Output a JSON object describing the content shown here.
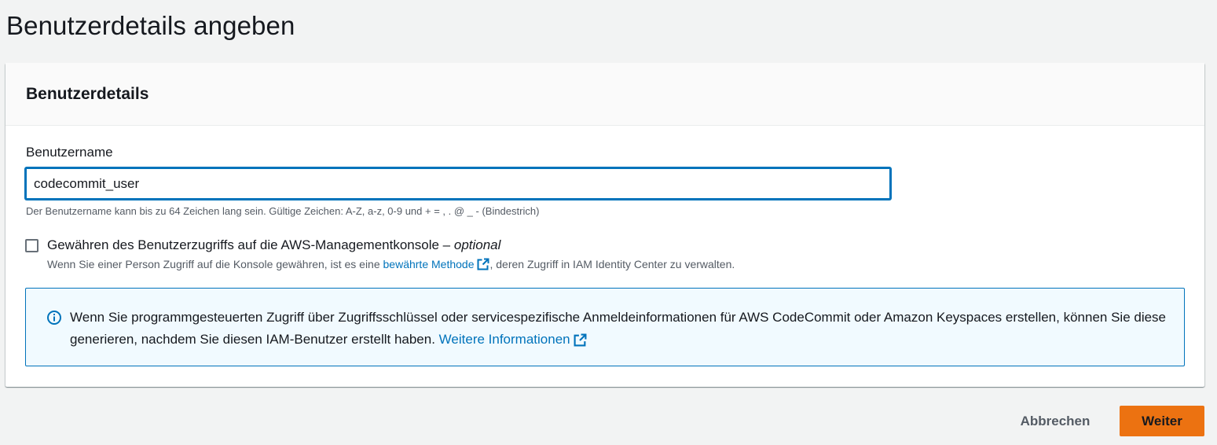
{
  "page": {
    "title": "Benutzerdetails angeben"
  },
  "user_details": {
    "heading": "Benutzerdetails",
    "username": {
      "label": "Benutzername",
      "value": "codecommit_user",
      "constraint": "Der Benutzername kann bis zu 64 Zeichen lang sein. Gültige Zeichen: A-Z, a-z, 0-9 und + = , . @ _ - (Bindestrich)"
    },
    "console_access": {
      "label": "Gewähren des Benutzerzugriffs auf die AWS-Managementkonsole – ",
      "optional": "optional",
      "checked": false,
      "desc_prefix": "Wenn Sie einer Person Zugriff auf die Konsole gewähren, ist es eine ",
      "desc_link": "bewährte Methode",
      "desc_suffix": ", deren Zugriff in IAM Identity Center zu verwalten."
    },
    "info_alert": {
      "text": "Wenn Sie programmgesteuerten Zugriff über Zugriffsschlüssel oder servicespezifische Anmeldeinformationen für AWS CodeCommit oder Amazon Keyspaces erstellen, können Sie diese generieren, nachdem Sie diesen IAM-Benutzer erstellt haben. ",
      "link": "Weitere Informationen"
    }
  },
  "actions": {
    "cancel": "Abbrechen",
    "next": "Weiter"
  },
  "icons": {
    "info": "info-icon",
    "external_link": "external-link-icon"
  },
  "colors": {
    "primary_button": "#ec7211",
    "link": "#0073bb",
    "info_background": "#f1faff"
  }
}
